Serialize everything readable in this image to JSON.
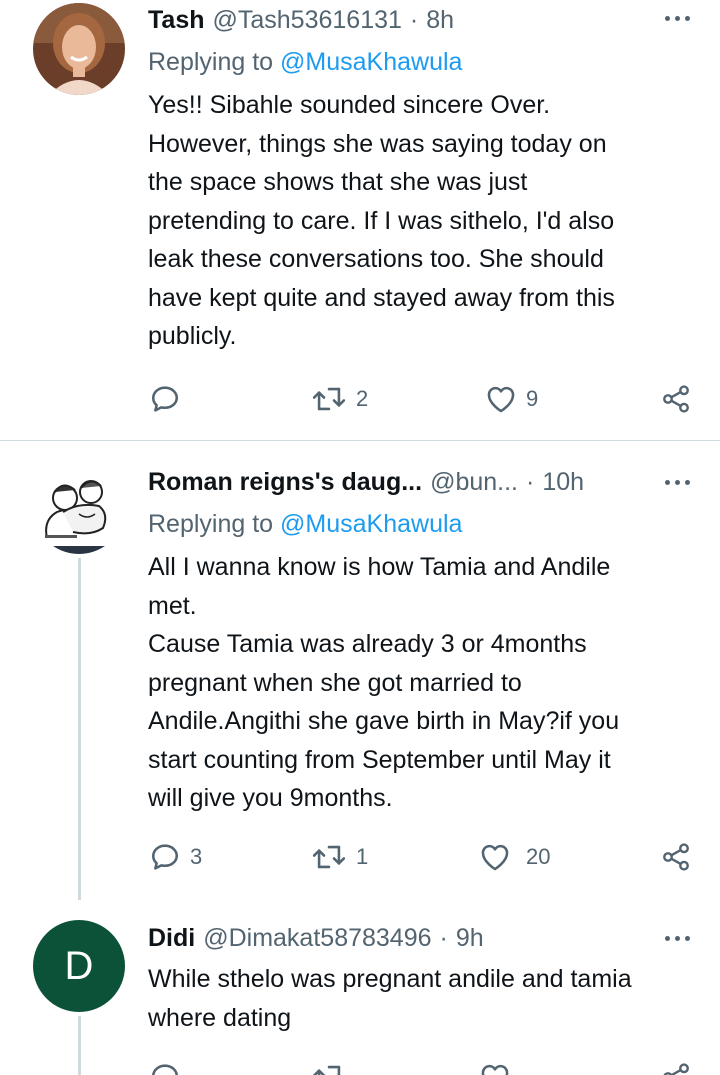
{
  "tweets": [
    {
      "name": "Tash",
      "handle": "@Tash53616131",
      "time": "8h",
      "reply_label": "Replying to",
      "reply_to": "@MusaKhawula",
      "lines": [
        "Yes!! Sibahle sounded sincere Over.",
        "However,  things she was saying today on",
        "the space shows that she was just",
        "pretending to care. If I was sithelo, I'd also",
        "leak these conversations too. She should",
        "have kept quite and stayed away from this",
        "publicly."
      ],
      "replies": "",
      "retweets": "2",
      "likes": "9"
    },
    {
      "name": "Roman reigns's daug...",
      "handle": "@bun...",
      "time": "10h",
      "reply_label": "Replying to",
      "reply_to": "@MusaKhawula",
      "lines": [
        "All I wanna know is how Tamia and Andile",
        "met.",
        "Cause Tamia was already 3 or 4months",
        "pregnant when she got married to",
        "Andile.Angithi she gave birth in May?if you",
        "start counting from September until May it",
        "will give you 9months."
      ],
      "replies": "3",
      "retweets": "1",
      "likes": "20"
    },
    {
      "name": "Didi",
      "handle": "@Dimakat58783496",
      "time": "9h",
      "avatar_letter": "D",
      "lines": [
        "While sthelo was pregnant andile and tamia",
        "where dating"
      ],
      "replies": "",
      "retweets": "",
      "likes": ""
    }
  ],
  "separator": "·",
  "colors": {
    "text": "#0f1419",
    "secondary": "#536471",
    "link": "#1d9bf0",
    "avatar_d_bg": "#0b5238"
  },
  "icons": [
    "reply-icon",
    "retweet-icon",
    "like-icon",
    "share-icon",
    "more-icon"
  ]
}
